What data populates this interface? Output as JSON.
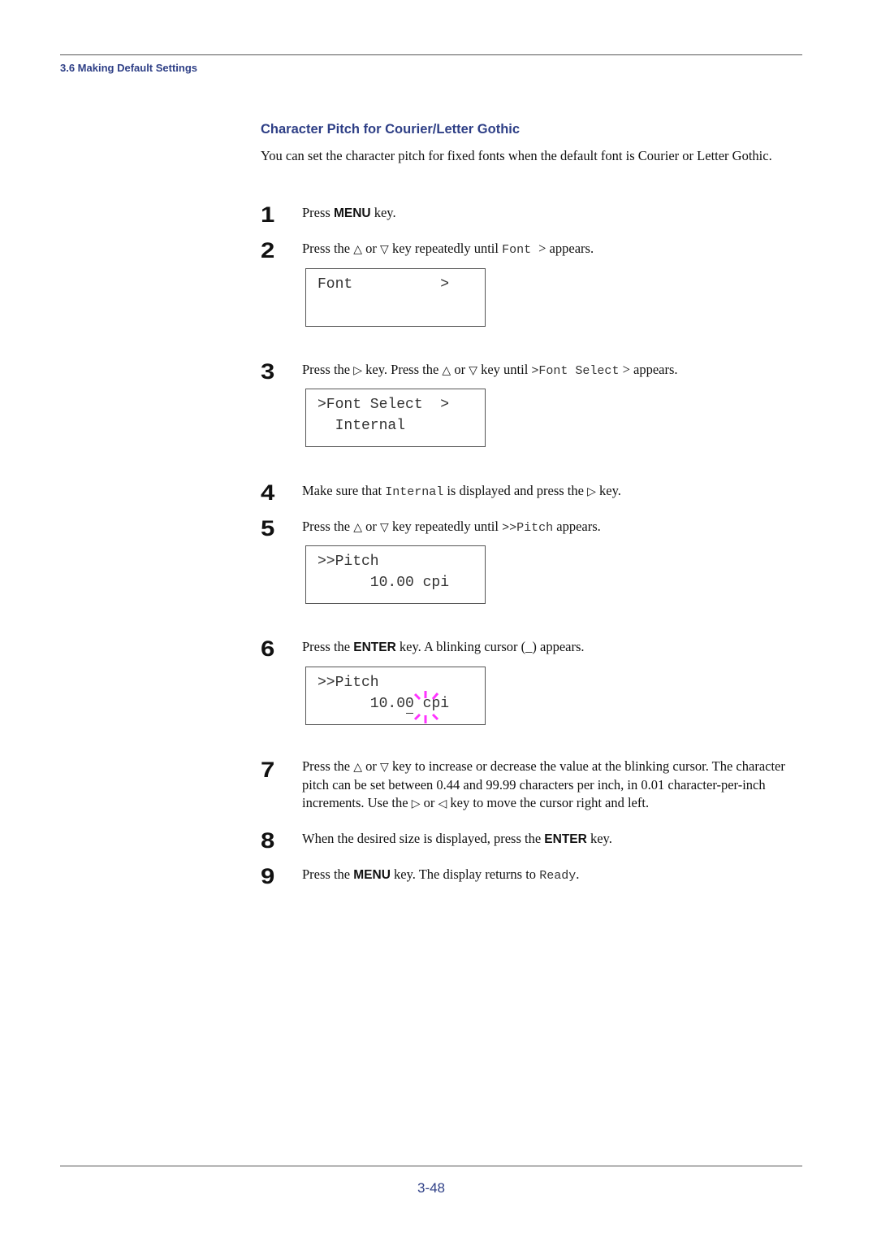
{
  "header": {
    "section": "3.6 Making Default Settings"
  },
  "heading": "Character Pitch for Courier/Letter Gothic",
  "intro": "You can set the character pitch for fixed fonts when the default font is Courier or Letter Gothic.",
  "symbols": {
    "up": "△",
    "down": "▽",
    "right": "▷",
    "left": "◁"
  },
  "steps": [
    {
      "num": "1",
      "parts": {
        "a": "Press ",
        "key": "MENU",
        "b": " key."
      }
    },
    {
      "num": "2",
      "parts": {
        "a": "Press the ",
        "b": " or ",
        "c": " key repeatedly until ",
        "code": "Font  ",
        "d": " > appears."
      }
    },
    {
      "num": "3",
      "parts": {
        "a": "Press the ",
        "b": " key. Press the ",
        "c": " or ",
        "d": " key until ",
        "code": ">Font Select",
        "e": " > appears."
      }
    },
    {
      "num": "4",
      "parts": {
        "a": "Make sure that ",
        "code": "Internal",
        "b": " is displayed and press the ",
        "c": " key."
      }
    },
    {
      "num": "5",
      "parts": {
        "a": "Press the ",
        "b": " or ",
        "c": " key repeatedly until ",
        "code": ">>Pitch",
        "d": " appears."
      }
    },
    {
      "num": "6",
      "parts": {
        "a": "Press the ",
        "key": "ENTER",
        "b": " key. A blinking cursor (_) appears."
      }
    },
    {
      "num": "7",
      "parts": {
        "a": "Press the ",
        "b": " or ",
        "c": " key to increase or decrease the value at the blinking cursor. The character pitch can be set between 0.44 and 99.99 characters per inch, in 0.01 character-per-inch increments. Use the ",
        "d": " or ",
        "e": " key to move the cursor right and left."
      }
    },
    {
      "num": "8",
      "parts": {
        "a": "When the desired size is displayed, press the ",
        "key": "ENTER",
        "b": " key."
      }
    },
    {
      "num": "9",
      "parts": {
        "a": "Press the ",
        "key": "MENU",
        "b": " key. The display returns to ",
        "code": "Ready",
        "c": "."
      }
    }
  ],
  "displays": {
    "font": {
      "line1": "Font          >",
      "line2": ""
    },
    "font_select": {
      "line1": ">Font Select  >",
      "line2": "  Internal"
    },
    "pitch": {
      "line1": ">>Pitch",
      "line2": "      10.00 cpi"
    },
    "pitch_cursor": {
      "line1": ">>Pitch",
      "line2_before": "      10.0",
      "line2_cursor": "0",
      "line2_after": " cpi"
    }
  },
  "colors": {
    "accent": "#2e3f86",
    "cursor_blink": "#ff33ff"
  },
  "footer": {
    "page_number": "3-48"
  }
}
